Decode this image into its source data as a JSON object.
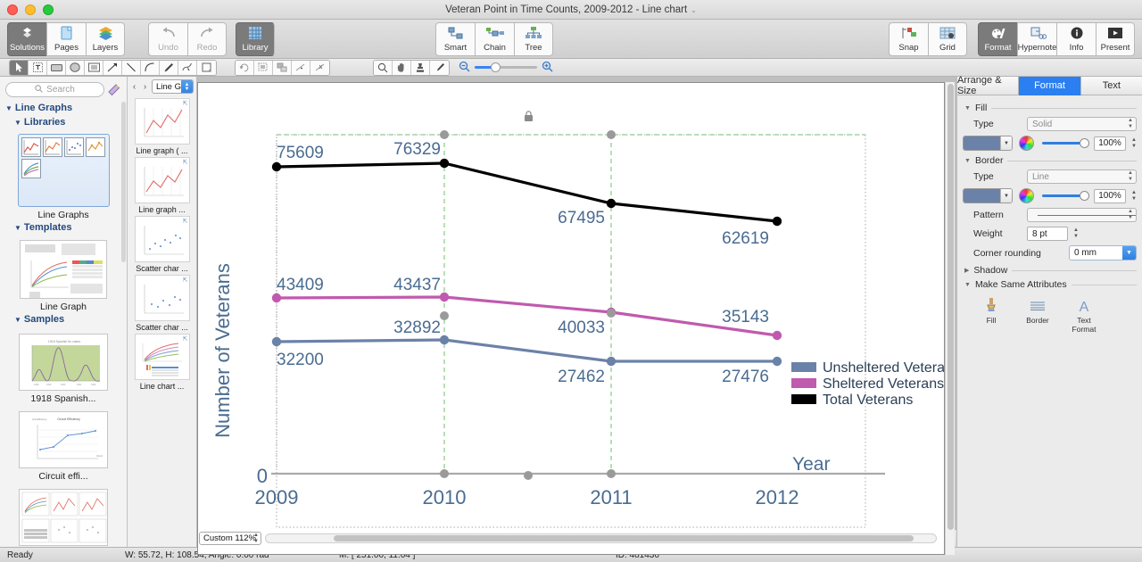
{
  "window": {
    "title": "Veteran Point in Time Counts, 2009-2012 - Line chart",
    "title_chevron": "⌄"
  },
  "toolbar": {
    "left": [
      {
        "label": "Solutions",
        "icon": "solutions-icon",
        "active": true
      },
      {
        "label": "Pages",
        "icon": "pages-icon",
        "active": false
      },
      {
        "label": "Layers",
        "icon": "layers-icon",
        "active": false
      }
    ],
    "history": [
      {
        "label": "Undo",
        "icon": "undo-arrow-icon",
        "disabled": true
      },
      {
        "label": "Redo",
        "icon": "redo-arrow-icon",
        "disabled": true
      }
    ],
    "library": {
      "label": "Library",
      "icon": "library-grid-icon",
      "active": true
    },
    "connectors": [
      {
        "label": "Smart",
        "icon": "smart-connector-icon"
      },
      {
        "label": "Chain",
        "icon": "chain-connector-icon"
      },
      {
        "label": "Tree",
        "icon": "tree-connector-icon"
      }
    ],
    "guides": [
      {
        "label": "Snap",
        "icon": "snap-icon"
      },
      {
        "label": "Grid",
        "icon": "grid-icon"
      }
    ],
    "inspectors": [
      {
        "label": "Format",
        "icon": "format-palette-icon",
        "active": true
      },
      {
        "label": "Hypernote",
        "icon": "hypernote-icon",
        "active": false
      },
      {
        "label": "Info",
        "icon": "info-circle-icon",
        "active": false
      },
      {
        "label": "Present",
        "icon": "present-play-icon",
        "active": false
      }
    ]
  },
  "tools": {
    "draw": [
      "pointer-icon",
      "text-box-icon",
      "rectangle-icon",
      "ellipse-icon",
      "frame-icon",
      "arrow-icon",
      "line-icon",
      "curve-icon",
      "pen-icon",
      "bezier-icon",
      "note-icon"
    ],
    "edit": [
      "rotate-icon",
      "group-icon",
      "ungroup-icon",
      "connect-icon",
      "disconnect-icon"
    ],
    "view": [
      "zoom-icon",
      "hand-icon",
      "stamp-icon",
      "eyedropper-icon"
    ],
    "zoom_out_icon": "zoom-out-icon",
    "zoom_in_icon": "zoom-in-icon"
  },
  "sidebar": {
    "search_placeholder": "Search",
    "search_icon": "search-icon",
    "wand_icon": "magic-wand-icon",
    "root": "Line Graphs",
    "sections": [
      {
        "label": "Libraries"
      },
      {
        "label": "Templates"
      },
      {
        "label": "Samples"
      }
    ],
    "library_item": "Line Graphs",
    "template_item": "Line Graph",
    "samples": [
      "1918 Spanish...",
      "Circuit effi..."
    ]
  },
  "library_panel": {
    "selector_value": "Line G...",
    "prev_icon": "chevron-left-icon",
    "next_icon": "chevron-right-icon",
    "items": [
      {
        "caption": "Line graph ( ..."
      },
      {
        "caption": "Line graph  ..."
      },
      {
        "caption": "Scatter char ..."
      },
      {
        "caption": "Scatter char ..."
      },
      {
        "caption": "Line chart  ..."
      }
    ]
  },
  "canvas": {
    "zoom_value": "Custom 112%",
    "lock_icon": "lock-icon"
  },
  "format_panel": {
    "tabs": [
      {
        "label": "Arrange & Size",
        "selected": false
      },
      {
        "label": "Format",
        "selected": true
      },
      {
        "label": "Text",
        "selected": false
      }
    ],
    "fill": {
      "group": "Fill",
      "type_label": "Type",
      "type_value": "Solid",
      "opacity": "100%",
      "color": "#6b82a8"
    },
    "border": {
      "group": "Border",
      "type_label": "Type",
      "type_value": "Line",
      "opacity": "100%",
      "color": "#6b82a8",
      "pattern_label": "Pattern",
      "weight_label": "Weight",
      "weight_value": "8 pt",
      "corner_label": "Corner rounding",
      "corner_value": "0 mm"
    },
    "shadow": {
      "group": "Shadow"
    },
    "make_same": {
      "group": "Make Same Attributes",
      "items": [
        {
          "label": "Fill",
          "icon": "fill-bucket-icon"
        },
        {
          "label": "Border",
          "icon": "border-lines-icon"
        },
        {
          "label": "Text\nFormat",
          "icon": "text-format-icon"
        }
      ]
    }
  },
  "status": {
    "state": "Ready",
    "size": "W: 55.72,  H: 108.54,  Angle: 0.00 rad",
    "mouse": "M: [ 251.00, 11.04 ]",
    "id": "ID: 481436"
  },
  "chart_data": {
    "type": "line",
    "title": "Veteran Point in Time Counts, 2009-2012",
    "xlabel": "Year",
    "ylabel": "Number of Veterans",
    "categories": [
      "2009",
      "2010",
      "2011",
      "2012"
    ],
    "ylim": [
      0,
      80000
    ],
    "y_zero_label": "0",
    "grid": false,
    "legend_position": "right",
    "label_color": "#4a6c91",
    "series": [
      {
        "name": "Unsheltered Veterans",
        "color": "#6b82a8",
        "values": [
          32200,
          32892,
          27462,
          27476
        ]
      },
      {
        "name": "Sheltered Veterans",
        "color": "#c05aae",
        "values": [
          43409,
          43437,
          40033,
          35143
        ]
      },
      {
        "name": "Total Veterans",
        "color": "#000000",
        "values": [
          75609,
          76329,
          67495,
          62619
        ]
      }
    ]
  }
}
